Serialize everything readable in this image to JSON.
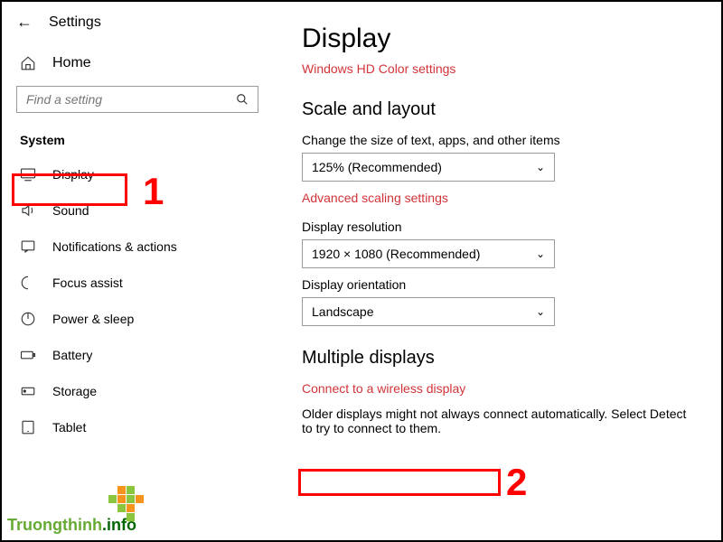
{
  "header": {
    "title": "Settings",
    "home_label": "Home",
    "search_placeholder": "Find a setting",
    "section_label": "System"
  },
  "sidebar": {
    "items": [
      {
        "icon": "display",
        "label": "Display"
      },
      {
        "icon": "sound",
        "label": "Sound"
      },
      {
        "icon": "notifications",
        "label": "Notifications & actions"
      },
      {
        "icon": "focus",
        "label": "Focus assist"
      },
      {
        "icon": "power",
        "label": "Power & sleep"
      },
      {
        "icon": "battery",
        "label": "Battery"
      },
      {
        "icon": "storage",
        "label": "Storage"
      },
      {
        "icon": "tablet",
        "label": "Tablet"
      }
    ]
  },
  "main": {
    "title": "Display",
    "hd_color_link": "Windows HD Color settings",
    "scale_section": "Scale and layout",
    "scale_label": "Change the size of text, apps, and other items",
    "scale_value": "125% (Recommended)",
    "adv_scaling_link": "Advanced scaling settings",
    "resolution_label": "Display resolution",
    "resolution_value": "1920 × 1080 (Recommended)",
    "orientation_label": "Display orientation",
    "orientation_value": "Landscape",
    "multiple_section": "Multiple displays",
    "wireless_link": "Connect to a wireless display",
    "older_note": "Older displays might not always connect automatically. Select Detect to try to connect to them."
  },
  "annotations": {
    "one": "1",
    "two": "2"
  },
  "watermark": {
    "brand": "Truongthinh",
    "suffix": ".info"
  }
}
